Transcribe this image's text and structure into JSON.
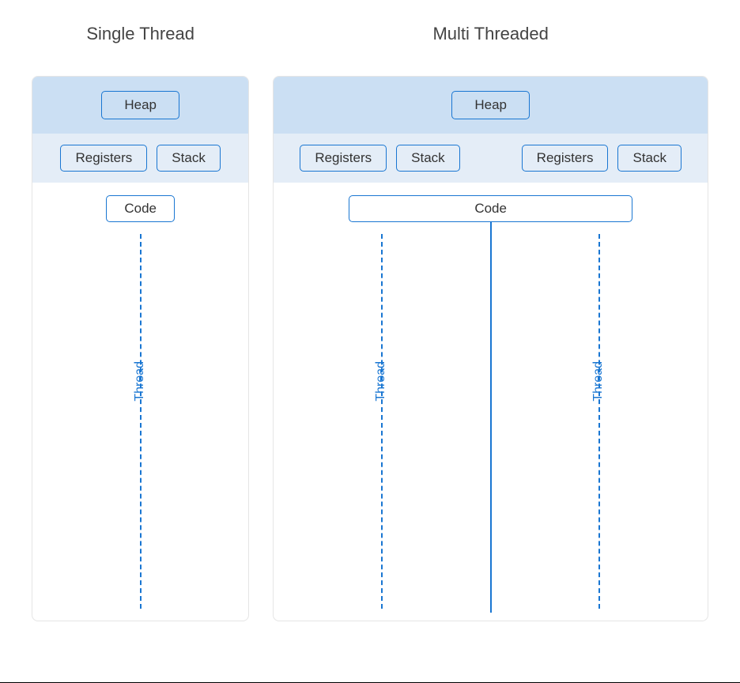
{
  "diagram": {
    "titles": {
      "single": "Single Thread",
      "multi": "Multi Threaded"
    },
    "labels": {
      "heap": "Heap",
      "registers": "Registers",
      "stack": "Stack",
      "code": "Code",
      "thread": "Thread"
    },
    "colors": {
      "accent": "#1976d2",
      "heap_band": "#cbdff3",
      "registers_band": "#e4edf7",
      "card_border": "#e5e5e5"
    },
    "structure": {
      "single": {
        "threads": 1
      },
      "multi": {
        "threads": 2,
        "shared": [
          "heap",
          "code"
        ],
        "per_thread": [
          "registers",
          "stack"
        ]
      }
    }
  }
}
